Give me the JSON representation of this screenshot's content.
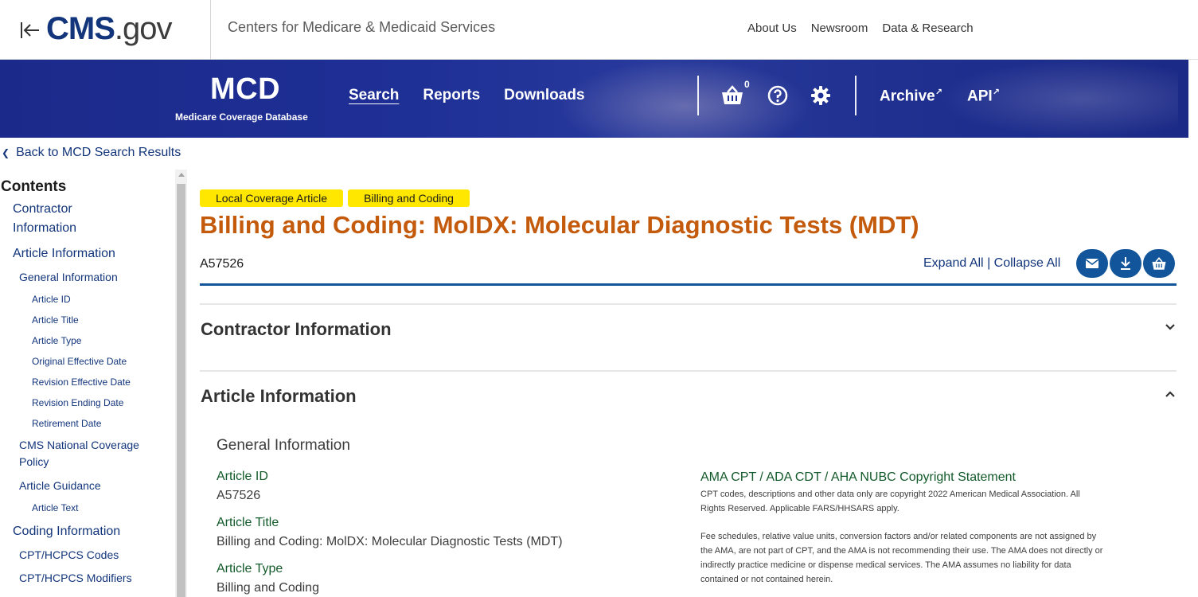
{
  "header": {
    "logo_bold": "CMS",
    "logo_light": ".gov",
    "agency": "Centers for Medicare & Medicaid Services",
    "links": [
      "About Us",
      "Newsroom",
      "Data & Research"
    ]
  },
  "banner": {
    "mcd": "MCD",
    "mcd_subtitle": "Medicare Coverage Database",
    "nav": [
      "Search",
      "Reports",
      "Downloads"
    ],
    "cart_count": "0",
    "archive": "Archive",
    "api": "API"
  },
  "back_link": "Back to MCD Search Results",
  "sidebar": {
    "title": "Contents",
    "items": [
      {
        "label": "Contractor",
        "level": 1
      },
      {
        "label": "Information",
        "level": 1
      },
      {
        "label": "Article Information",
        "level": 1
      },
      {
        "label": "General Information",
        "level": 2
      },
      {
        "label": "Article ID",
        "level": 3
      },
      {
        "label": "Article Title",
        "level": 3
      },
      {
        "label": "Article Type",
        "level": 3
      },
      {
        "label": "Original Effective Date",
        "level": 3
      },
      {
        "label": "Revision Effective Date",
        "level": 3
      },
      {
        "label": "Revision Ending Date",
        "level": 3
      },
      {
        "label": "Retirement Date",
        "level": 3
      },
      {
        "label": "CMS National Coverage",
        "level": 2
      },
      {
        "label": "Policy",
        "level": 2
      },
      {
        "label": "Article Guidance",
        "level": 2
      },
      {
        "label": "Article Text",
        "level": 3
      },
      {
        "label": "Coding Information",
        "level": 1
      },
      {
        "label": "CPT/HCPCS Codes",
        "level": 2
      },
      {
        "label": "CPT/HCPCS Modifiers",
        "level": 2
      }
    ]
  },
  "main": {
    "badges": [
      "Local Coverage Article",
      "Billing and Coding"
    ],
    "title": "Billing and Coding: MolDX: Molecular Diagnostic Tests (MDT)",
    "article_id": "A57526",
    "expand_all": "Expand All",
    "separator": "|",
    "collapse_all": "Collapse All",
    "sections": [
      "Contractor Information",
      "Article Information"
    ],
    "general_information": "General Information",
    "fields": [
      {
        "label": "Article ID",
        "value": "A57526"
      },
      {
        "label": "Article Title",
        "value": "Billing and Coding: MolDX: Molecular Diagnostic Tests (MDT)"
      },
      {
        "label": "Article Type",
        "value": "Billing and Coding"
      }
    ],
    "ama": {
      "title": "AMA CPT / ADA CDT / AHA NUBC Copyright Statement",
      "para1_line1": "CPT codes, descriptions and other data only are copyright 2022 American Medical Association. All",
      "para1_line2": "Rights Reserved. Applicable FARS/HHSARS apply.",
      "para2_line1": "Fee schedules, relative value units, conversion factors and/or related components are not assigned by",
      "para2_line2": "the AMA, are not part of CPT, and the AMA is not recommending their use. The AMA does not directly or",
      "para2_line3": "indirectly practice medicine or dispense medical services. The AMA assumes no liability for data",
      "para2_line4": "contained or not contained herein."
    }
  },
  "colors": {
    "brand_blue": "#12357b",
    "banner_blue": "#1e2f96",
    "title_orange": "#c45a0c",
    "badge_yellow": "#ffe700",
    "label_green": "#125a2a"
  }
}
